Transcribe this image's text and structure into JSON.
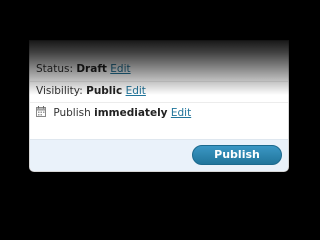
{
  "publish_box": {
    "status": {
      "label": "Status:",
      "value": "Draft",
      "edit_label": "Edit"
    },
    "visibility": {
      "label": "Visibility:",
      "value": "Public",
      "edit_label": "Edit"
    },
    "schedule": {
      "icon": "calendar-icon",
      "label": "Publish",
      "value": "immediately",
      "edit_label": "Edit"
    },
    "publish_button_label": "Publish"
  },
  "colors": {
    "link": "#21759b",
    "button": "#21759b",
    "action_bar": "#eaf2fa",
    "background": "#000000"
  }
}
